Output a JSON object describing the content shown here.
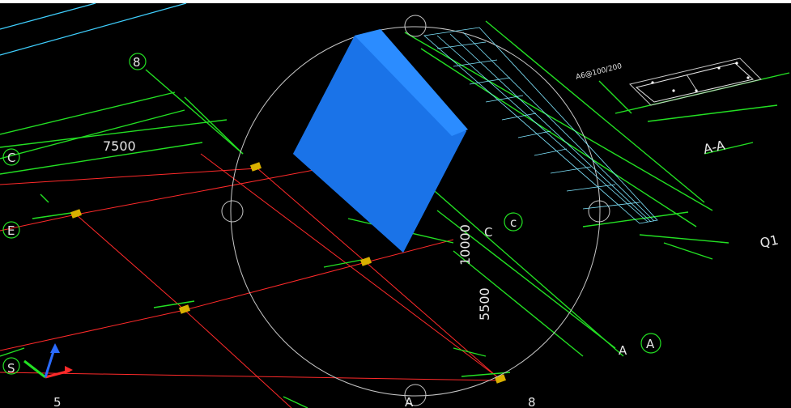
{
  "dimensions": {
    "span_7500": "7500",
    "span_10000": "10000",
    "span_5500": "5500"
  },
  "axes": {
    "axis_8_top": "8",
    "axis_C_left": "C",
    "axis_E_left": "E",
    "axis_S_left": "S",
    "axis_5_bottom": "5",
    "axis_C_mid": "C",
    "axis_c_mid": "c",
    "axis_A_right": "A",
    "axis_a_right": "A",
    "axis_A_bottom": "A",
    "axis_8_bottom": "8"
  },
  "labels": {
    "section_AA": "A-A",
    "wall_Q1": "Q1",
    "rebar_note": "A6@100/200"
  },
  "colors": {
    "background": "#000000",
    "grid_red": "#ff2a2a",
    "dim_green": "#23e023",
    "wall_blue": "#1a73e8",
    "mesh_cyan": "#7fe6ff",
    "column_yellow": "#d9b000",
    "orbit_circle": "#c8c8c8"
  },
  "gizmo": {
    "icon": "ucs-axes-icon"
  }
}
